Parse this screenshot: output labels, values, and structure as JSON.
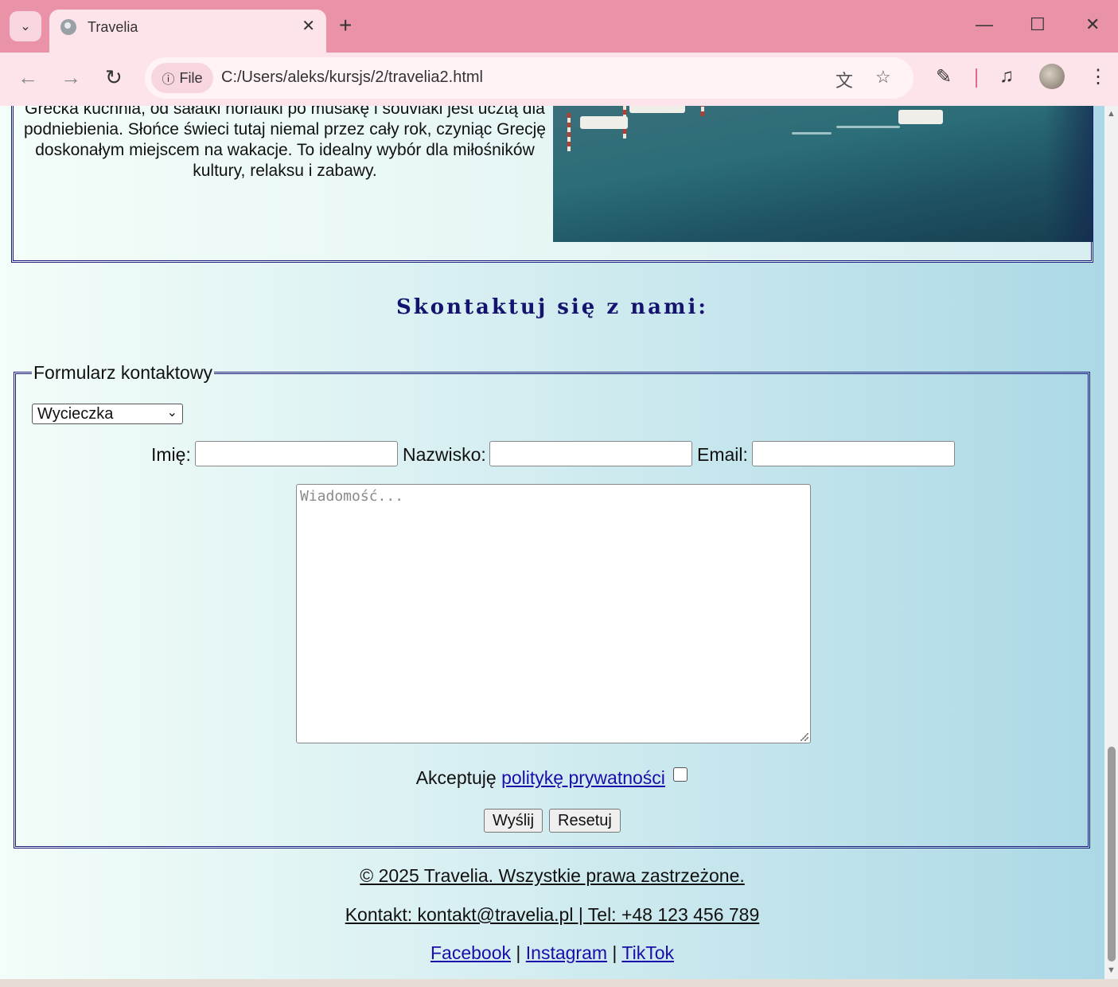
{
  "browser": {
    "tab_title": "Travelia",
    "tab_close": "✕",
    "new_tab": "+",
    "file_chip": "File",
    "url": "C:/Users/aleks/kursjs/2/travelia2.html",
    "window_minimize": "—",
    "window_maximize": "☐",
    "window_close": "✕"
  },
  "article": {
    "text": "Grecka kuchnia, od sałatki horiatiki po musakę i souvlaki jest ucztą dla podniebienia. Słońce świeci tutaj niemal przez cały rok, czyniąc Grecję doskonałym miejscem na wakacje. To idealny wybór dla miłośników kultury, relaksu i zabawy."
  },
  "contact": {
    "heading": "Skontaktuj się z nami:",
    "legend": "Formularz kontaktowy",
    "select_value": "Wycieczka",
    "label_first_name": "Imię:",
    "label_last_name": "Nazwisko:",
    "label_email": "Email:",
    "message_placeholder": "Wiadomość...",
    "consent_prefix": "Akceptuję",
    "consent_link": "politykę prywatności",
    "submit_label": "Wyślij",
    "reset_label": "Resetuj"
  },
  "footer": {
    "copyright": "© 2025 Travelia. Wszystkie prawa zastrzeżone.",
    "contact": "Kontakt: kontakt@travelia.pl | Tel: +48 123 456 789",
    "social": [
      "Facebook",
      "Instagram",
      "TikTok"
    ],
    "separator": "|"
  },
  "colors": {
    "chrome_tabbar": "#ea93a8",
    "chrome_toolbar": "#fde3ea",
    "heading": "#14146e",
    "link": "#1a0dab",
    "border": "#1c1c7a"
  }
}
